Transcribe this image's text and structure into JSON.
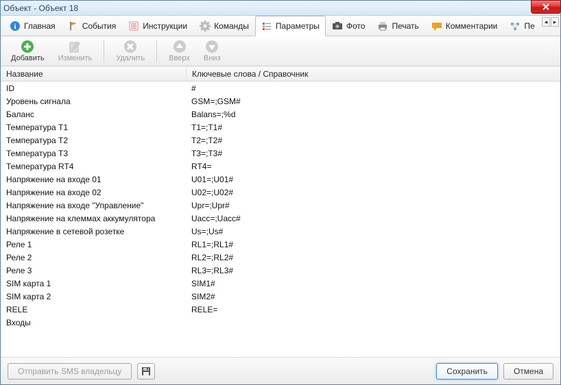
{
  "window": {
    "title": "Объект - Объект 18"
  },
  "tabs": {
    "items": [
      {
        "label": "Главная"
      },
      {
        "label": "События"
      },
      {
        "label": "Инструкции"
      },
      {
        "label": "Команды"
      },
      {
        "label": "Параметры"
      },
      {
        "label": "Фото"
      },
      {
        "label": "Печать"
      },
      {
        "label": "Комментарии"
      },
      {
        "label": "Пе"
      }
    ],
    "active_index": 4
  },
  "toolbar": {
    "add": "Добавить",
    "edit": "Изменить",
    "delete": "Удалить",
    "up": "Вверх",
    "down": "Вниз"
  },
  "grid": {
    "headers": {
      "name": "Название",
      "keywords": "Ключевые слова / Справочник"
    },
    "rows": [
      {
        "name": "ID",
        "key": "#"
      },
      {
        "name": "Уровень сигнала",
        "key": "GSM=;GSM#"
      },
      {
        "name": "Баланс",
        "key": "Balans=;%d"
      },
      {
        "name": "Температура T1",
        "key": "T1=;T1#"
      },
      {
        "name": "Температура T2",
        "key": "T2=;T2#"
      },
      {
        "name": "Температура T3",
        "key": "T3=;T3#"
      },
      {
        "name": "Температура RT4",
        "key": "RT4="
      },
      {
        "name": "Напряжение на входе 01",
        "key": "U01=;U01#"
      },
      {
        "name": "Напряжение на входе 02",
        "key": "U02=;U02#"
      },
      {
        "name": "Напряжение на входе \"Управление\"",
        "key": "Upr=;Upr#"
      },
      {
        "name": "Напряжение на клеммах аккумулятора",
        "key": "Uacc=;Uacc#"
      },
      {
        "name": "Напряжение в сетевой розетке",
        "key": "Us=;Us#"
      },
      {
        "name": "Реле 1",
        "key": "RL1=;RL1#"
      },
      {
        "name": "Реле 2",
        "key": "RL2=;RL2#"
      },
      {
        "name": "Реле 3",
        "key": "RL3=;RL3#"
      },
      {
        "name": "SIM карта 1",
        "key": "SIM1#"
      },
      {
        "name": "SIM карта 2",
        "key": "SIM2#"
      },
      {
        "name": "RELE",
        "key": "RELE="
      },
      {
        "name": "Входы",
        "key": ""
      }
    ]
  },
  "bottom": {
    "send_sms": "Отправить SMS владельцу",
    "save": "Сохранить",
    "cancel": "Отмена"
  }
}
